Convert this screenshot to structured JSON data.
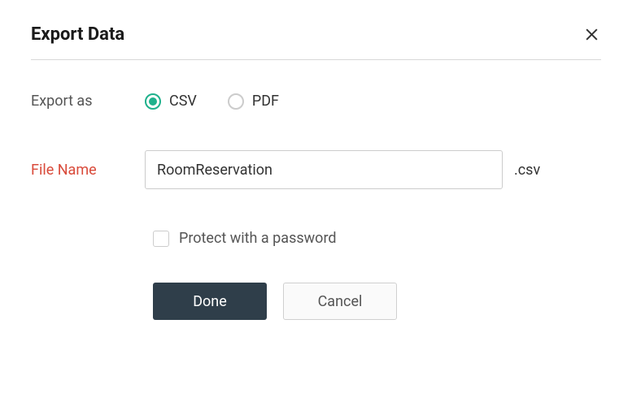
{
  "dialog": {
    "title": "Export Data"
  },
  "exportAs": {
    "label": "Export as",
    "options": [
      {
        "label": "CSV",
        "selected": true
      },
      {
        "label": "PDF",
        "selected": false
      }
    ]
  },
  "fileName": {
    "label": "File Name",
    "value": "RoomReservation",
    "extension": ".csv"
  },
  "protect": {
    "label": "Protect with a password",
    "checked": false
  },
  "buttons": {
    "done": "Done",
    "cancel": "Cancel"
  }
}
